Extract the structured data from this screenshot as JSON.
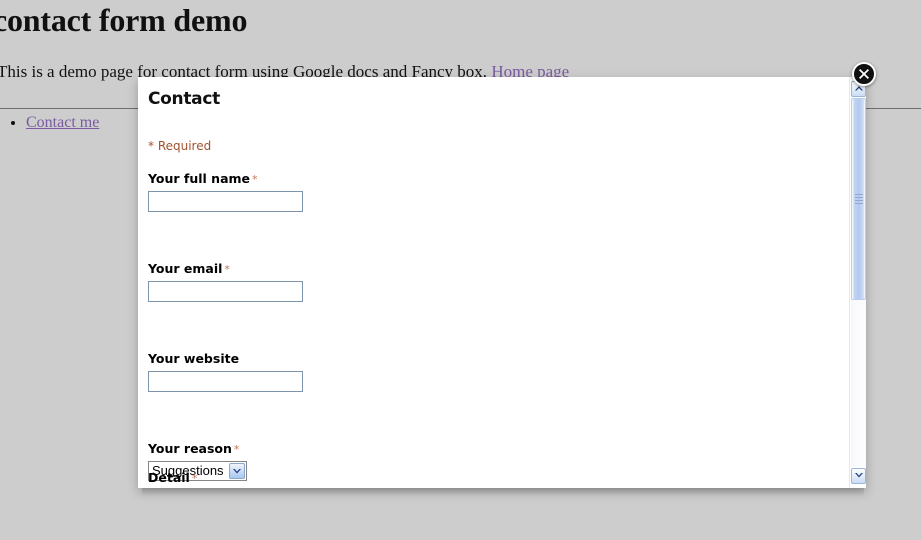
{
  "page": {
    "title": "contact form demo",
    "intro_before": "This is a demo page for contact form using Google docs and Fancy box.",
    "home_link": "Home page",
    "nav": [
      {
        "label": "Contact me"
      }
    ]
  },
  "modal": {
    "heading": "Contact",
    "required_note": "* Required",
    "required_star": "*",
    "close_icon": "close-icon",
    "cut_off_label": "Detail",
    "fields": [
      {
        "label": "Your full name",
        "required": true,
        "value": "",
        "placeholder": "",
        "type": "text"
      },
      {
        "label": "Your email",
        "required": true,
        "value": "",
        "placeholder": "",
        "type": "text"
      },
      {
        "label": "Your website",
        "required": false,
        "value": "",
        "placeholder": "",
        "type": "text"
      },
      {
        "label": "Your reason",
        "required": true,
        "value": "Suggestions",
        "type": "select"
      }
    ],
    "select_selected": "Suggestions",
    "scrollbar": {
      "up_icon": "chevron-up-icon",
      "down_icon": "chevron-down-icon"
    }
  },
  "colors": {
    "page_background": "#cdcdcd",
    "modal_background": "#ffffff",
    "link": "#7a5ba0",
    "required": "#a0522d",
    "input_border": "#7e94ab",
    "scrollbar_thumb": "#b3c9ef"
  }
}
